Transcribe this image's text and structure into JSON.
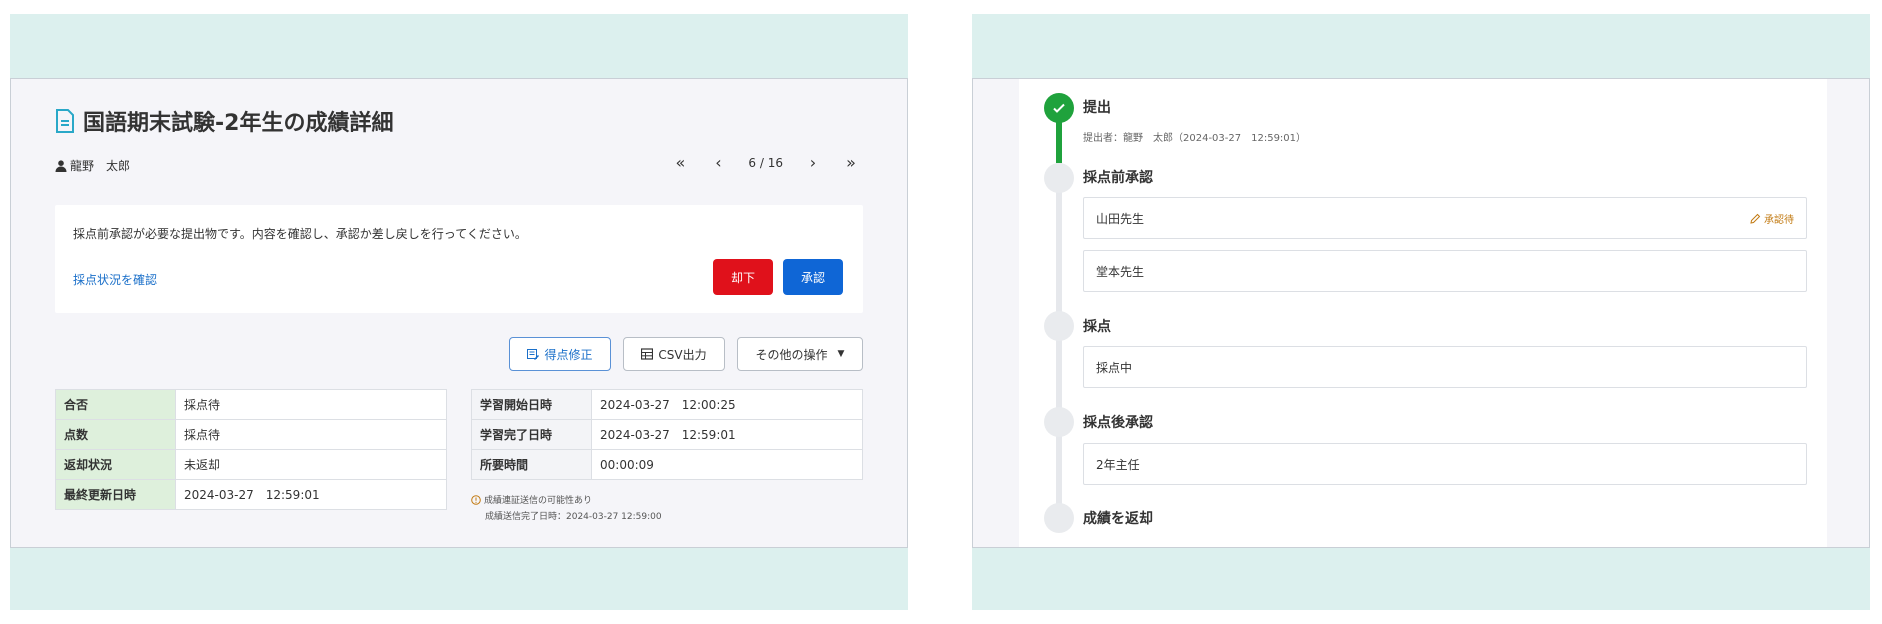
{
  "left": {
    "title": "国語期末試験-2年生の成績詳細",
    "user_name": "龍野　太郎",
    "pager": {
      "first": "«",
      "prev": "‹",
      "count": "6 / 16",
      "next": "›",
      "last": "»"
    },
    "notice": {
      "message": "採点前承認が必要な提出物です。内容を確認し、承認か差し戻しを行ってください。",
      "link": "採点状況を確認",
      "reject_label": "却下",
      "approve_label": "承認"
    },
    "actions": {
      "score_edit": "得点修正",
      "csv": "CSV出力",
      "other": "その他の操作"
    },
    "table_left": [
      {
        "label": "合否",
        "value": "採点待"
      },
      {
        "label": "点数",
        "value": "採点待"
      },
      {
        "label": "返却状況",
        "value": "未返却"
      },
      {
        "label": "最終更新日時",
        "value": "2024-03-27　12:59:01"
      }
    ],
    "table_right": [
      {
        "label": "学習開始日時",
        "value": "2024-03-27　12:00:25"
      },
      {
        "label": "学習完了日時",
        "value": "2024-03-27　12:59:01"
      },
      {
        "label": "所要時間",
        "value": "00:00:09"
      }
    ],
    "warning": "成績連証送信の可能性あり",
    "sent_time": "成績送信完了日時：2024-03-27 12:59:00"
  },
  "right": {
    "steps": {
      "submit": {
        "title": "提出",
        "sub": "提出者：龍野　太郎（2024-03-27　12:59:01）"
      },
      "pre_approval": {
        "title": "採点前承認",
        "approvers": [
          {
            "name": "山田先生",
            "status": "承認待"
          },
          {
            "name": "堂本先生",
            "status": ""
          }
        ]
      },
      "grading": {
        "title": "採点",
        "box": "採点中"
      },
      "post_approval": {
        "title": "採点後承認",
        "box": "2年主任"
      },
      "return": {
        "title": "成績を返却"
      }
    }
  },
  "colors": {
    "background": "#dcf0ee",
    "reject": "#e0111b",
    "approve": "#0f66d6",
    "link": "#1a6fc9",
    "done": "#1fa23c",
    "pending": "#c27a12",
    "table_header_green": "#def0dc"
  },
  "icons": {
    "title": "document-icon",
    "user": "user-icon",
    "score_edit": "score-edit-icon",
    "csv": "table-icon",
    "warning": "info-circle-icon",
    "pending": "pencil-icon",
    "done": "check-icon"
  }
}
